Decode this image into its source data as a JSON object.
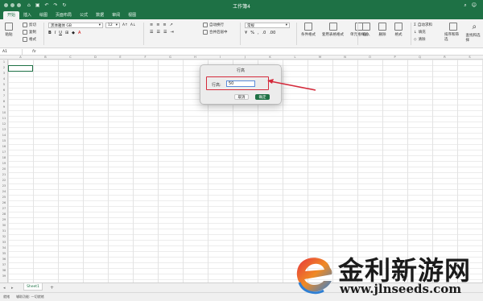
{
  "window": {
    "title": "工作簿4",
    "qat_icons": [
      "home-icon",
      "save-icon",
      "undo-icon",
      "redo-icon",
      "repeat-icon"
    ]
  },
  "tabs": [
    "开始",
    "插入",
    "绘图",
    "页面布局",
    "公式",
    "数据",
    "审阅",
    "视图"
  ],
  "active_tab": "开始",
  "ribbon": {
    "paste": "粘贴",
    "cut": "剪切",
    "copy": "复制",
    "format_painter": "格式",
    "font_name": "黑体雅体 GB",
    "font_size": "12",
    "wrap_text": "自动换行",
    "merge_center": "合并后居中",
    "number_format": "常规",
    "cond_format": "条件格式",
    "format_table": "套用表格格式",
    "cell_styles": "单元格样式",
    "insert": "插入",
    "delete": "删除",
    "format": "格式",
    "autosum": "自动求和",
    "fill": "填充",
    "clear": "清除",
    "sort_filter": "排序和筛选",
    "find_select": "查找和选择"
  },
  "formula_bar": {
    "name_box": "A1",
    "fx_label": "fx",
    "value": ""
  },
  "columns": [
    "A",
    "B",
    "C",
    "D",
    "E",
    "F",
    "G",
    "H",
    "I",
    "J",
    "K",
    "L",
    "M",
    "N",
    "O",
    "P",
    "Q",
    "R",
    "S"
  ],
  "rows": [
    "1",
    "2",
    "3",
    "4",
    "5",
    "6",
    "7",
    "8",
    "9",
    "10",
    "11",
    "12",
    "13",
    "14",
    "15",
    "16",
    "17",
    "18",
    "19",
    "20",
    "21",
    "22",
    "23",
    "24",
    "25",
    "26",
    "27",
    "28",
    "29",
    "30",
    "31",
    "32",
    "33",
    "34",
    "35",
    "36",
    "37",
    "38",
    "39"
  ],
  "dialog": {
    "title": "行高",
    "field_label": "行高:",
    "field_value": "50",
    "cancel_label": "取消",
    "ok_label": "确定"
  },
  "sheet_tabs": {
    "active": "Sheet1",
    "add": "+"
  },
  "status_bar": {
    "ready": "就绪",
    "accessibility": "辅助功能: 一切就绪"
  },
  "watermark": {
    "brand": "金利新游网",
    "url": "www.jlnseeds.com"
  },
  "colors": {
    "accent": "#1e7145",
    "highlight": "#d42a3b"
  }
}
